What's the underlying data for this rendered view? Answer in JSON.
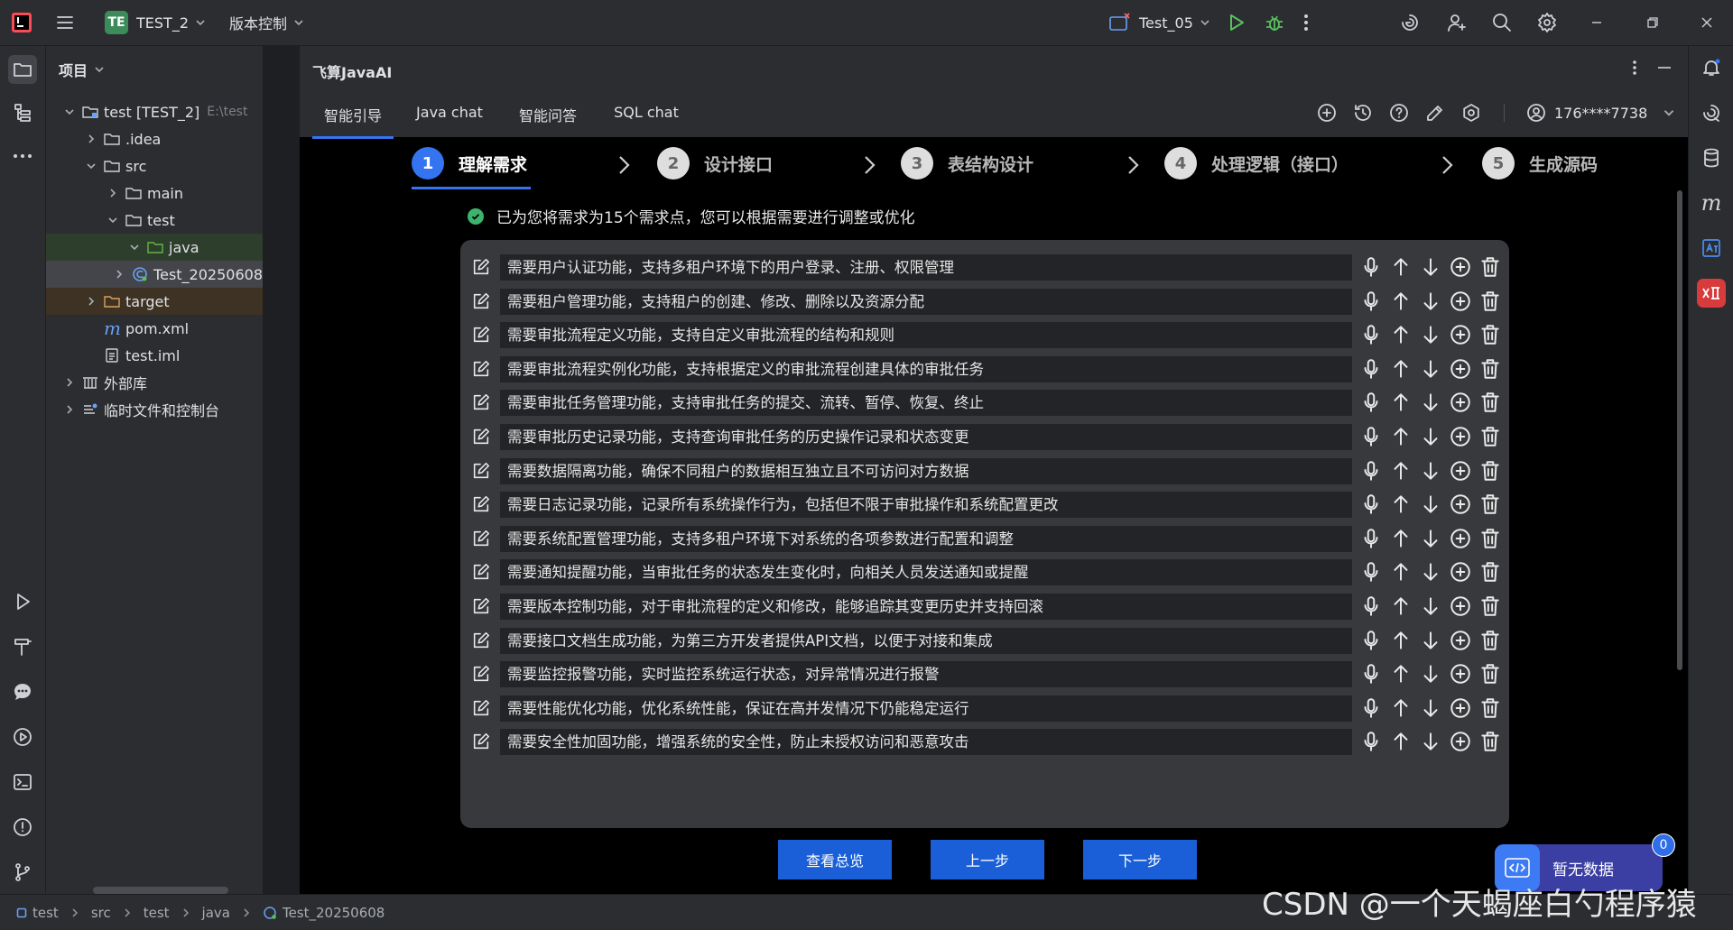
{
  "titlebar": {
    "project_badge": "TE",
    "project_name": "TEST_2",
    "vcs_menu": "版本控制",
    "run_config": "Test_05"
  },
  "project_panel": {
    "title": "项目",
    "tree": [
      {
        "label": "test [TEST_2]",
        "hint": "E:\\test",
        "depth": 0,
        "expanded": true,
        "icon": "module-folder-icon"
      },
      {
        "label": ".idea",
        "depth": 1,
        "expanded": false,
        "icon": "folder-icon"
      },
      {
        "label": "src",
        "depth": 1,
        "expanded": true,
        "icon": "folder-icon"
      },
      {
        "label": "main",
        "depth": 2,
        "expanded": false,
        "icon": "folder-icon"
      },
      {
        "label": "test",
        "depth": 2,
        "expanded": true,
        "icon": "folder-icon"
      },
      {
        "label": "java",
        "depth": 3,
        "expanded": true,
        "icon": "test-source-folder-icon"
      },
      {
        "label": "Test_20250608",
        "depth": 4,
        "expanded": false,
        "icon": "class-icon"
      },
      {
        "label": "target",
        "depth": 1,
        "expanded": false,
        "icon": "folder-icon"
      },
      {
        "label": "pom.xml",
        "depth": 1,
        "icon": "maven-icon"
      },
      {
        "label": "test.iml",
        "depth": 1,
        "icon": "file-icon"
      },
      {
        "label": "外部库",
        "depth": 0,
        "expanded": false,
        "icon": "library-icon"
      },
      {
        "label": "临时文件和控制台",
        "depth": 0,
        "expanded": false,
        "icon": "scratches-icon"
      }
    ]
  },
  "ai_panel": {
    "title": "飞算JavaAI",
    "tabs": [
      "智能引导",
      "Java chat",
      "智能问答",
      "SQL chat"
    ],
    "user": "176****7738",
    "steps": [
      {
        "num": "1",
        "label": "理解需求"
      },
      {
        "num": "2",
        "label": "设计接口"
      },
      {
        "num": "3",
        "label": "表结构设计"
      },
      {
        "num": "4",
        "label": "处理逻辑（接口）"
      },
      {
        "num": "5",
        "label": "生成源码"
      }
    ],
    "message": "已为您将需求为15个需求点，您可以根据需要进行调整或优化",
    "requirements": [
      "需要用户认证功能，支持多租户环境下的用户登录、注册、权限管理",
      "需要租户管理功能，支持租户的创建、修改、删除以及资源分配",
      "需要审批流程定义功能，支持自定义审批流程的结构和规则",
      "需要审批流程实例化功能，支持根据定义的审批流程创建具体的审批任务",
      "需要审批任务管理功能，支持审批任务的提交、流转、暂停、恢复、终止",
      "需要审批历史记录功能，支持查询审批任务的历史操作记录和状态变更",
      "需要数据隔离功能，确保不同租户的数据相互独立且不可访问对方数据",
      "需要日志记录功能，记录所有系统操作行为，包括但不限于审批操作和系统配置更改",
      "需要系统配置管理功能，支持多租户环境下对系统的各项参数进行配置和调整",
      "需要通知提醒功能，当审批任务的状态发生变化时，向相关人员发送通知或提醒",
      "需要版本控制功能，对于审批流程的定义和修改，能够追踪其变更历史并支持回滚",
      "需要接口文档生成功能，为第三方开发者提供API文档，以便于对接和集成",
      "需要监控报警功能，实时监控系统运行状态，对异常情况进行报警",
      "需要性能优化功能，优化系统性能，保证在高并发情况下仍能稳定运行",
      "需要安全性加固功能，增强系统的安全性，防止未授权访问和恶意攻击"
    ],
    "buttons": {
      "overview": "查看总览",
      "prev": "上一步",
      "next": "下一步"
    },
    "widget": {
      "label": "暂无数据",
      "badge": "0"
    }
  },
  "statusbar": {
    "breadcrumb": [
      "test",
      "src",
      "test",
      "java",
      "Test_20250608"
    ]
  },
  "watermark": "CSDN @一个天蝎座白勺程序猿",
  "colors": {
    "accent": "#3574f0",
    "button": "#1a5fd8",
    "success": "#3db46d"
  }
}
